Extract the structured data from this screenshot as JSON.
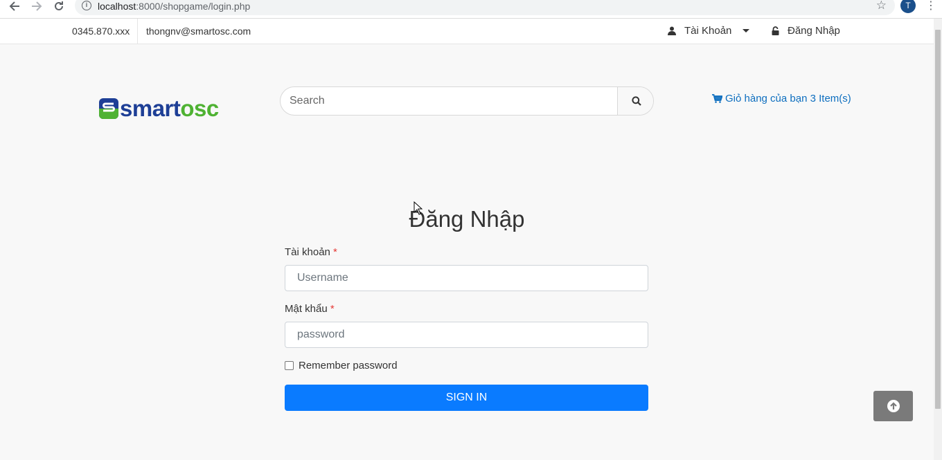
{
  "browser": {
    "url_host": "localhost",
    "url_path": ":8000/shopgame/login.php",
    "avatar_letter": "T"
  },
  "topbar": {
    "phone": "0345.870.xxx",
    "email": "thongnv@smartosc.com",
    "account_label": "Tài Khoản",
    "login_label": "Đăng Nhập"
  },
  "header": {
    "logo_text_1": "smart",
    "logo_text_2": "osc",
    "search_placeholder": "Search",
    "cart_label": "Giỏ hàng của bạn 3 Item(s)"
  },
  "login_form": {
    "title": "Đăng Nhập",
    "username_label": "Tài khoản",
    "username_placeholder": "Username",
    "password_label": "Mật khẩu",
    "password_placeholder": "password",
    "required_mark": "*",
    "remember_label": "Remember password",
    "remember_checked": false,
    "submit_label": "SIGN IN"
  },
  "colors": {
    "primary": "#0a7bff",
    "cart_link": "#0d6ebf",
    "logo_blue": "#1e3f96",
    "logo_green": "#4fb233",
    "required": "#e53935"
  },
  "icons": {
    "back": "arrow-left-icon",
    "forward": "arrow-right-icon",
    "reload": "reload-icon",
    "info": "info-icon",
    "star": "star-icon",
    "user": "user-icon",
    "lock": "lock-icon",
    "search": "search-icon",
    "cart": "cart-icon",
    "to_top": "arrow-circle-up-icon"
  }
}
